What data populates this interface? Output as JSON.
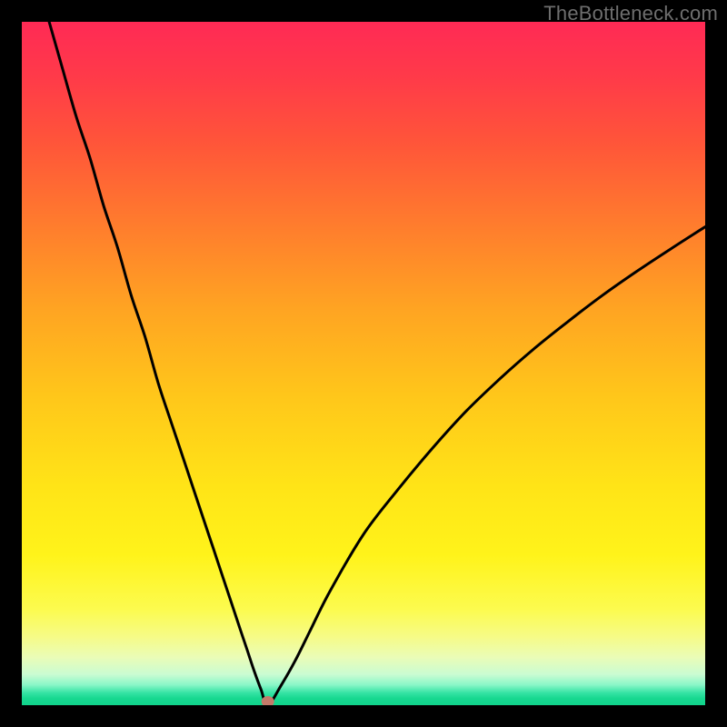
{
  "watermark": "TheBottleneck.com",
  "chart_data": {
    "type": "line",
    "title": "",
    "xlabel": "",
    "ylabel": "",
    "xlim": [
      0,
      100
    ],
    "ylim": [
      0,
      100
    ],
    "grid": false,
    "legend": false,
    "series": [
      {
        "name": "bottleneck-curve",
        "x": [
          4,
          6,
          8,
          10,
          12,
          14,
          16,
          18,
          20,
          22,
          24,
          26,
          28,
          30,
          31,
          32,
          33,
          34,
          35,
          36,
          38,
          40,
          42,
          45,
          50,
          55,
          60,
          65,
          70,
          75,
          80,
          85,
          90,
          95,
          100
        ],
        "values": [
          100,
          93,
          86,
          80,
          73,
          67,
          60,
          54,
          47,
          41,
          35,
          29,
          23,
          17,
          14,
          11,
          8,
          5,
          2.3,
          0,
          3.0,
          6.5,
          10.5,
          16.5,
          25,
          31.5,
          37.5,
          43,
          47.8,
          52.2,
          56.2,
          60,
          63.5,
          66.8,
          70
        ]
      }
    ],
    "marker": {
      "x": 36,
      "y": 0,
      "color": "#c47a6a"
    },
    "background_gradient": {
      "top": "#ff2a55",
      "mid": "#ffe417",
      "bottom": "#11d48c"
    }
  }
}
